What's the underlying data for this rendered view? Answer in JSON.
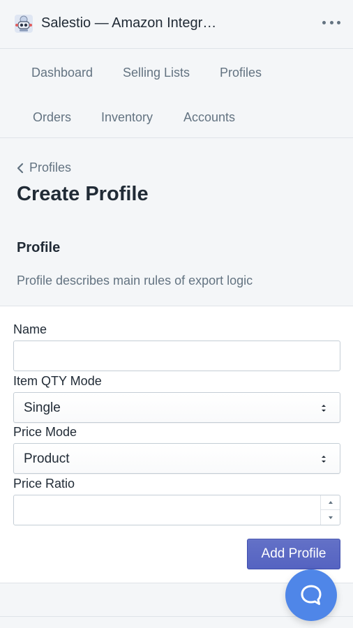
{
  "header": {
    "app_title": "Salestio — Amazon Integr…",
    "app_icon": "robot-app-icon",
    "more_icon": "more-horizontal-icon"
  },
  "nav": {
    "items": [
      {
        "label": "Dashboard"
      },
      {
        "label": "Selling Lists"
      },
      {
        "label": "Profiles"
      },
      {
        "label": "Orders"
      },
      {
        "label": "Inventory"
      },
      {
        "label": "Accounts"
      }
    ]
  },
  "page": {
    "breadcrumb": "Profiles",
    "title": "Create Profile",
    "section_title": "Profile",
    "section_description": "Profile describes main rules of export logic"
  },
  "form": {
    "name": {
      "label": "Name",
      "value": ""
    },
    "item_qty_mode": {
      "label": "Item QTY Mode",
      "value": "Single"
    },
    "price_mode": {
      "label": "Price Mode",
      "value": "Product"
    },
    "price_ratio": {
      "label": "Price Ratio",
      "value": ""
    },
    "submit_label": "Add Profile"
  },
  "colors": {
    "primary": "#5c6ac4",
    "chat": "#4f86e8",
    "muted_text": "#637381"
  },
  "chat": {
    "icon": "chat-bubble-icon"
  }
}
